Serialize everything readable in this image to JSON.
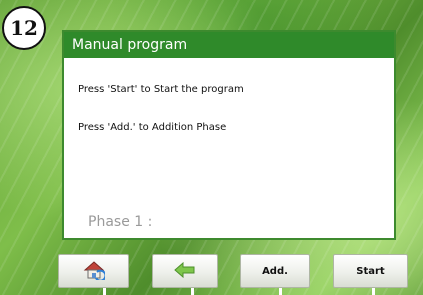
{
  "step_badge": "12",
  "dialog": {
    "title": "Manual program",
    "line1": "Press 'Start' to Start the program",
    "line2": "Press 'Add.' to Addition Phase",
    "phase_label": "Phase 1 :"
  },
  "toolbar": {
    "home_icon": "home-icon",
    "back_icon": "back-arrow-icon",
    "add_label": "Add.",
    "start_label": "Start"
  },
  "colors": {
    "title_bar": "#2f8a2a",
    "background_green": "#6faf3f",
    "phase_text": "#9a9a9a",
    "back_arrow": "#7ec64b"
  }
}
